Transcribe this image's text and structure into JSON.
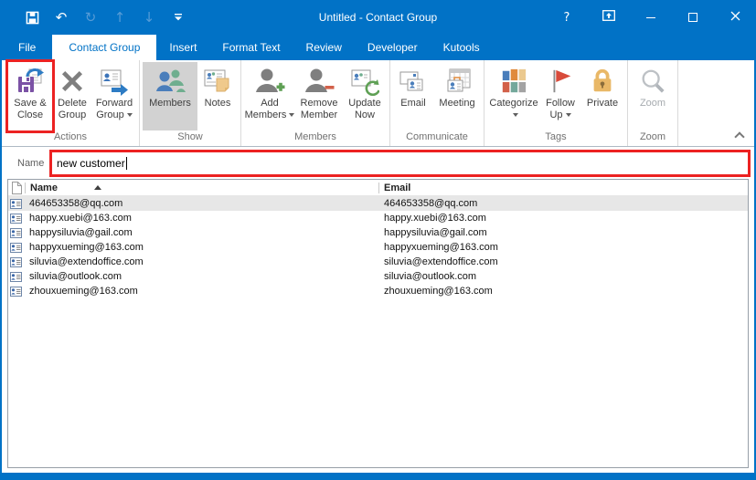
{
  "titlebar": {
    "title": "Untitled  -  Contact Group",
    "qat_icons": [
      "save-icon",
      "undo-icon",
      "redo-icon",
      "move-up-icon",
      "move-down-icon",
      "customize-quick-access-icon"
    ],
    "window_controls": [
      "help",
      "ribbon-display-options",
      "minimize",
      "maximize",
      "close"
    ],
    "help_glyph": "?"
  },
  "tabs": [
    {
      "label": "File",
      "active": false
    },
    {
      "label": "Contact Group",
      "active": true
    },
    {
      "label": "Insert",
      "active": false
    },
    {
      "label": "Format Text",
      "active": false
    },
    {
      "label": "Review",
      "active": false
    },
    {
      "label": "Developer",
      "active": false
    },
    {
      "label": "Kutools",
      "active": false
    }
  ],
  "ribbon": {
    "groups": [
      {
        "label": "Actions",
        "buttons": [
          {
            "label": "Save & Close",
            "annotated": true
          },
          {
            "label": "Delete Group"
          },
          {
            "label": "Forward Group",
            "dropdown": true
          }
        ]
      },
      {
        "label": "Show",
        "buttons": [
          {
            "label": "Members",
            "active": true
          },
          {
            "label": "Notes"
          }
        ]
      },
      {
        "label": "Members",
        "buttons": [
          {
            "label": "Add Members",
            "dropdown": true
          },
          {
            "label": "Remove Member"
          },
          {
            "label": "Update Now"
          }
        ]
      },
      {
        "label": "Communicate",
        "buttons": [
          {
            "label": "Email"
          },
          {
            "label": "Meeting"
          }
        ]
      },
      {
        "label": "Tags",
        "buttons": [
          {
            "label": "Categorize",
            "dropdown": true
          },
          {
            "label": "Follow Up",
            "dropdown": true
          },
          {
            "label": "Private"
          }
        ]
      },
      {
        "label": "Zoom",
        "buttons": [
          {
            "label": "Zoom",
            "disabled": true
          }
        ]
      }
    ]
  },
  "form": {
    "name_label": "Name",
    "name_value": "new customer"
  },
  "list": {
    "columns": [
      "Name",
      "Email"
    ],
    "sort": "ascending",
    "rows": [
      {
        "name": "464653358@qq.com",
        "email": "464653358@qq.com",
        "selected": true
      },
      {
        "name": "happy.xuebi@163.com",
        "email": "happy.xuebi@163.com",
        "selected": false
      },
      {
        "name": "happysiluvia@gail.com",
        "email": "happysiluvia@gail.com",
        "selected": false
      },
      {
        "name": "happyxueming@163.com",
        "email": "happyxueming@163.com",
        "selected": false
      },
      {
        "name": "siluvia@extendoffice.com",
        "email": "siluvia@extendoffice.com",
        "selected": false
      },
      {
        "name": "siluvia@outlook.com",
        "email": "siluvia@outlook.com",
        "selected": false
      },
      {
        "name": "zhouxueming@163.com",
        "email": "zhouxueming@163.com",
        "selected": false
      }
    ]
  },
  "colors": {
    "accent_blue": "#0172C6",
    "annotation_red": "#EC2222",
    "active_button_bg": "#D2D2D2",
    "selected_row_bg": "#E7E7E7"
  }
}
